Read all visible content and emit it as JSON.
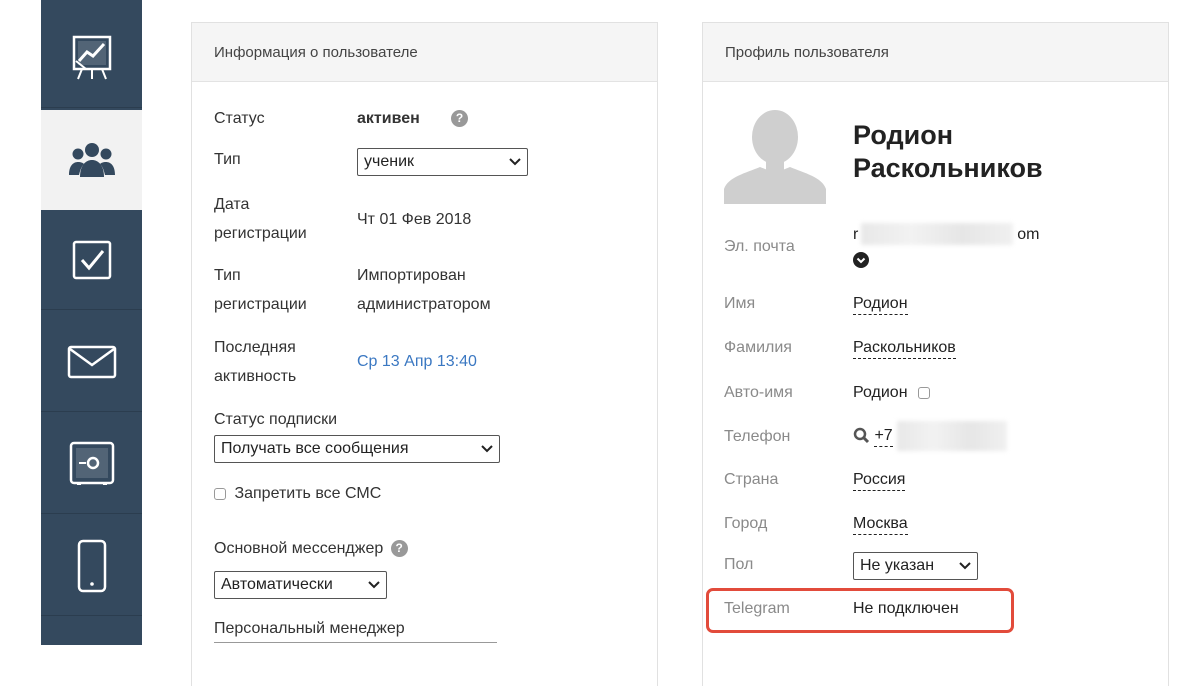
{
  "sidebar": {
    "items": [
      {
        "icon": "chart-board-icon"
      },
      {
        "icon": "users-icon",
        "active": true
      },
      {
        "icon": "checkbox-icon"
      },
      {
        "icon": "envelope-icon"
      },
      {
        "icon": "safe-icon"
      },
      {
        "icon": "mobile-phone-icon"
      }
    ]
  },
  "user_info": {
    "title": "Информация о пользователе",
    "status_label": "Статус",
    "status_value": "активен",
    "type_label": "Тип",
    "type_value": "ученик",
    "reg_date_label_1": "Дата",
    "reg_date_label_2": "регистрации",
    "reg_date_value": "Чт 01 Фев 2018",
    "reg_type_label_1": "Тип",
    "reg_type_label_2": "регистрации",
    "reg_type_value_1": "Импортирован",
    "reg_type_value_2": "администратором",
    "last_activity_label_1": "Последняя",
    "last_activity_label_2": "активность",
    "last_activity_value": "Ср 13 Апр 13:40",
    "subscription_label": "Статус подписки",
    "subscription_value": "Получать все сообщения",
    "block_sms_label": "Запретить все СМС",
    "messenger_label": "Основной мессенджер",
    "messenger_value": "Автоматически",
    "manager_label": "Персональный менеджер"
  },
  "profile": {
    "title": "Профиль пользователя",
    "first_name_display": "Родион",
    "last_name_display": "Раскольников",
    "email_label": "Эл. почта",
    "email_start": "r",
    "email_end": "om",
    "name_label": "Имя",
    "name_value": "Родион",
    "surname_label": "Фамилия",
    "surname_value": "Раскольников",
    "autoname_label": "Авто-имя",
    "autoname_value": "Родион",
    "phone_label": "Телефон",
    "phone_value": "+7",
    "country_label": "Страна",
    "country_value": "Россия",
    "city_label": "Город",
    "city_value": "Москва",
    "gender_label": "Пол",
    "gender_value": "Не указан",
    "telegram_label": "Telegram",
    "telegram_value": "Не подключен"
  },
  "colors": {
    "sidebar": "#34495e",
    "link": "#3b78c2",
    "highlight": "#e24b3b"
  }
}
